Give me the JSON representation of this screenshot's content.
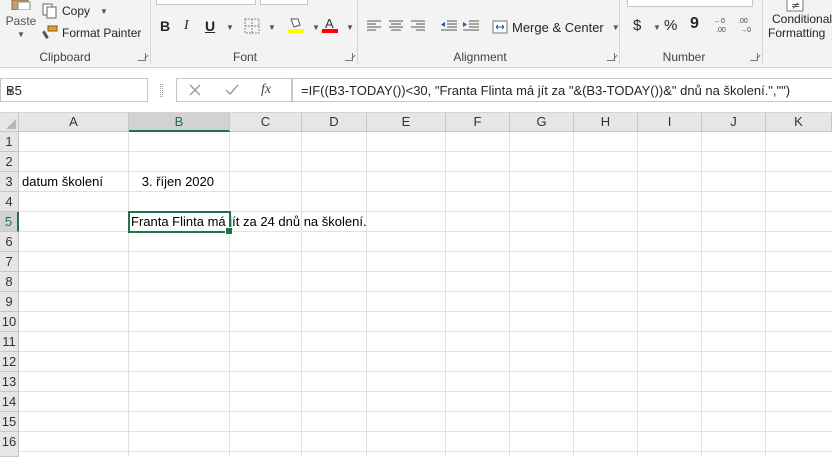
{
  "ribbon": {
    "clipboard": {
      "label": "Clipboard",
      "paste": "Paste",
      "copy": "Copy",
      "format_painter": "Format Painter"
    },
    "font": {
      "label": "Font",
      "bold": "B",
      "italic": "I",
      "underline": "U",
      "fill_color": "#ffff00",
      "font_color": "#ff0000"
    },
    "alignment": {
      "label": "Alignment",
      "merge_center": "Merge & Center"
    },
    "number": {
      "label": "Number",
      "currency": "$",
      "percent": "%",
      "comma": "9"
    },
    "styles": {
      "conditional_line1": "Conditional",
      "conditional_line2": "Formatting"
    }
  },
  "formula_bar": {
    "name_box": "B5",
    "fx": "fx",
    "formula": "=IF((B3-TODAY())<30, \"Franta Flinta má jít za \"&(B3-TODAY())&\" dnů na školení.\",\"\")"
  },
  "sheet": {
    "columns": [
      "A",
      "B",
      "C",
      "D",
      "E",
      "F",
      "G",
      "H",
      "I",
      "J",
      "K"
    ],
    "rows": [
      "1",
      "2",
      "3",
      "4",
      "5",
      "6",
      "7",
      "8",
      "9",
      "10",
      "11",
      "12",
      "13",
      "14",
      "15",
      "16"
    ],
    "selected_column": "B",
    "selected_row": "5",
    "cells": {
      "A3": "datum školení",
      "B3": "3. říjen 2020",
      "B5": "Franta Flinta má jít za 24 dnů na školení."
    }
  },
  "colors": {
    "accent": "#217346",
    "ribbon_bg": "#f3f3f3",
    "gridline": "#e1e1e1"
  }
}
